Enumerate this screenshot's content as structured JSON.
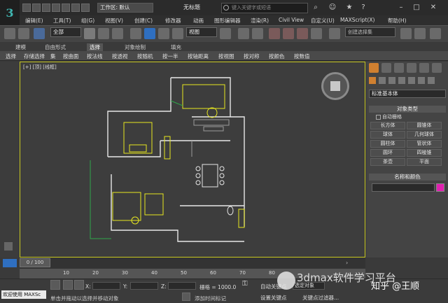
{
  "app": {
    "logo": "3",
    "workspace": "工作区: 默认",
    "doc_title": "无标题",
    "search_placeholder": "键入关键字或短语"
  },
  "menu": [
    "编辑(E)",
    "工具(T)",
    "组(G)",
    "视图(V)",
    "创建(C)",
    "修改器",
    "动画",
    "图形编辑器",
    "渲染(R)",
    "Civil View",
    "自定义(U)",
    "MAXScript(X)",
    "帮助(H)"
  ],
  "toolbar": {
    "selection_filter": "全部",
    "ref_coord": "视图",
    "named_selection": "创建选择集"
  },
  "ribbon": {
    "tabs": [
      "建模",
      "自由形式",
      "选择",
      "对象绘制",
      "填充"
    ],
    "active_tab": "选择",
    "commands": [
      "选择",
      "存储选择",
      "集",
      "按曲面",
      "按法线",
      "按透视",
      "按随机",
      "按一半",
      "按轴距离",
      "按视图",
      "按对称",
      "按颜色",
      "按数值"
    ]
  },
  "viewport": {
    "label": "[+] [顶] [线框]",
    "border_color": "#c8c820"
  },
  "command_panel": {
    "primitive_type": "标准基本体",
    "object_type_header": "对象类型",
    "autogrid": "自动栅格",
    "object_buttons": [
      "长方体",
      "圆锥体",
      "球体",
      "几何球体",
      "圆柱体",
      "管状体",
      "圆环",
      "四棱锥",
      "茶壶",
      "平面"
    ],
    "name_color_header": "名称和颜色",
    "color": "#e020b0"
  },
  "timeline": {
    "thumb": "0 / 100",
    "ticks": [
      "0",
      "10",
      "20",
      "30",
      "40",
      "50",
      "60",
      "70",
      "80",
      "90",
      "100"
    ]
  },
  "status": {
    "welcome": "欢迎使用 MAXSc",
    "prompt": "单击并拖动以选择并移动对象",
    "x_label": "X:",
    "y_label": "Y:",
    "z_label": "Z:",
    "grid": "栅格 = 1000.0",
    "add_time_tag": "添加时间标记",
    "auto_key": "自动关键点",
    "selected": "选定对象",
    "set_key": "设置关键点",
    "key_filters": "关键点过滤器..."
  },
  "overlay": {
    "watermark": "3dmax软件学习平台",
    "zhihu": "知乎 @王顺"
  }
}
